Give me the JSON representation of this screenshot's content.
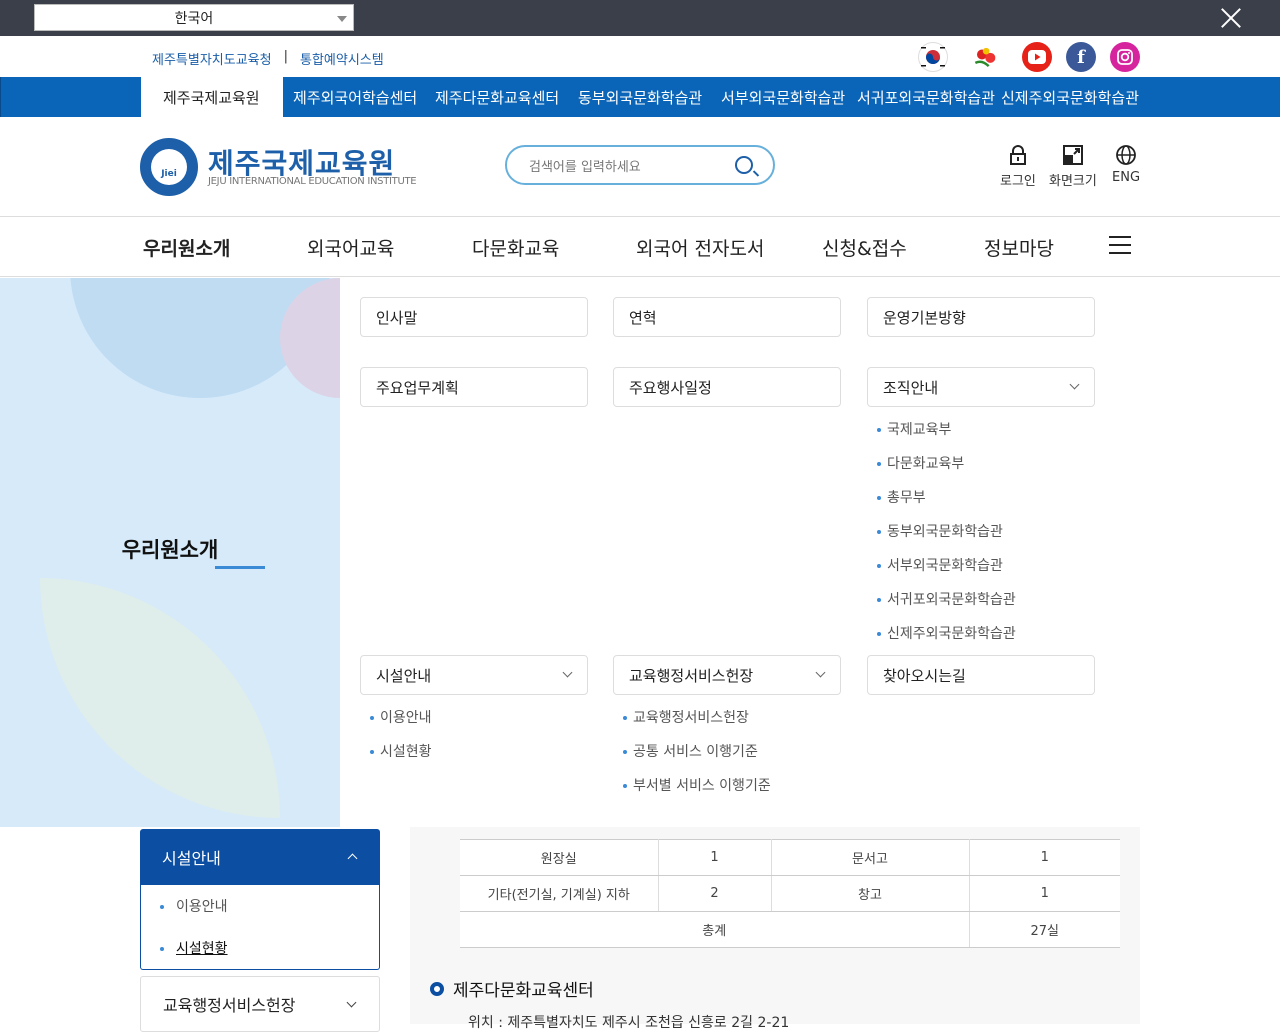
{
  "topbar": {
    "language": "한국어"
  },
  "util": {
    "link1": "제주특별자치도교육청",
    "sep": "|",
    "link2": "통합예약시스템"
  },
  "sites": {
    "active": "제주국제교육원",
    "items": [
      "제주외국어학습센터",
      "제주다문화교육센터",
      "동부외국문화학습관",
      "서부외국문화학습관",
      "서귀포외국문화학습관",
      "신제주외국문화학습관"
    ]
  },
  "logo": {
    "emblem_text": "Jiei",
    "title": "제주국제교육원",
    "subtitle": "JEJU INTERNATIONAL EDUCATION INSTITUTE"
  },
  "search": {
    "placeholder": "검색어를 입력하세요"
  },
  "header_tools": {
    "login": "로그인",
    "screen": "화면크기",
    "eng": "ENG"
  },
  "gnb": [
    "우리원소개",
    "외국어교육",
    "다문화교육",
    "외국어 전자도서",
    "신청&접수",
    "정보마당"
  ],
  "mega": {
    "title": "우리원소개",
    "row1": [
      "인사말",
      "연혁",
      "운영기본방향"
    ],
    "row2": [
      "주요업무계획",
      "주요행사일정",
      "조직안내"
    ],
    "org_subs": [
      "국제교육부",
      "다문화교육부",
      "총무부",
      "동부외국문화학습관",
      "서부외국문화학습관",
      "서귀포외국문화학습관",
      "신제주외국문화학습관"
    ],
    "row3": [
      "시설안내",
      "교육행정서비스헌장",
      "찾아오시는길"
    ],
    "facility_subs": [
      "이용안내",
      "시설현황"
    ],
    "charter_subs": [
      "교육행정서비스헌장",
      "공통 서비스 이행기준",
      "부서별 서비스 이행기준"
    ]
  },
  "lnb": {
    "head": "시설안내",
    "subs": [
      "이용안내",
      "시설현황"
    ],
    "next": "교육행정서비스헌장"
  },
  "table": {
    "rows": [
      [
        "원장실",
        "1",
        "문서고",
        "1"
      ],
      [
        "기타(전기실, 기계실) 지하",
        "2",
        "창고",
        "1"
      ]
    ],
    "total_label": "총계",
    "total_value": "27실"
  },
  "section": {
    "title": "제주다문화교육센터",
    "address": "위치 : 제주특별자치도 제주시 조천읍 신흥로 2길 2-21"
  }
}
